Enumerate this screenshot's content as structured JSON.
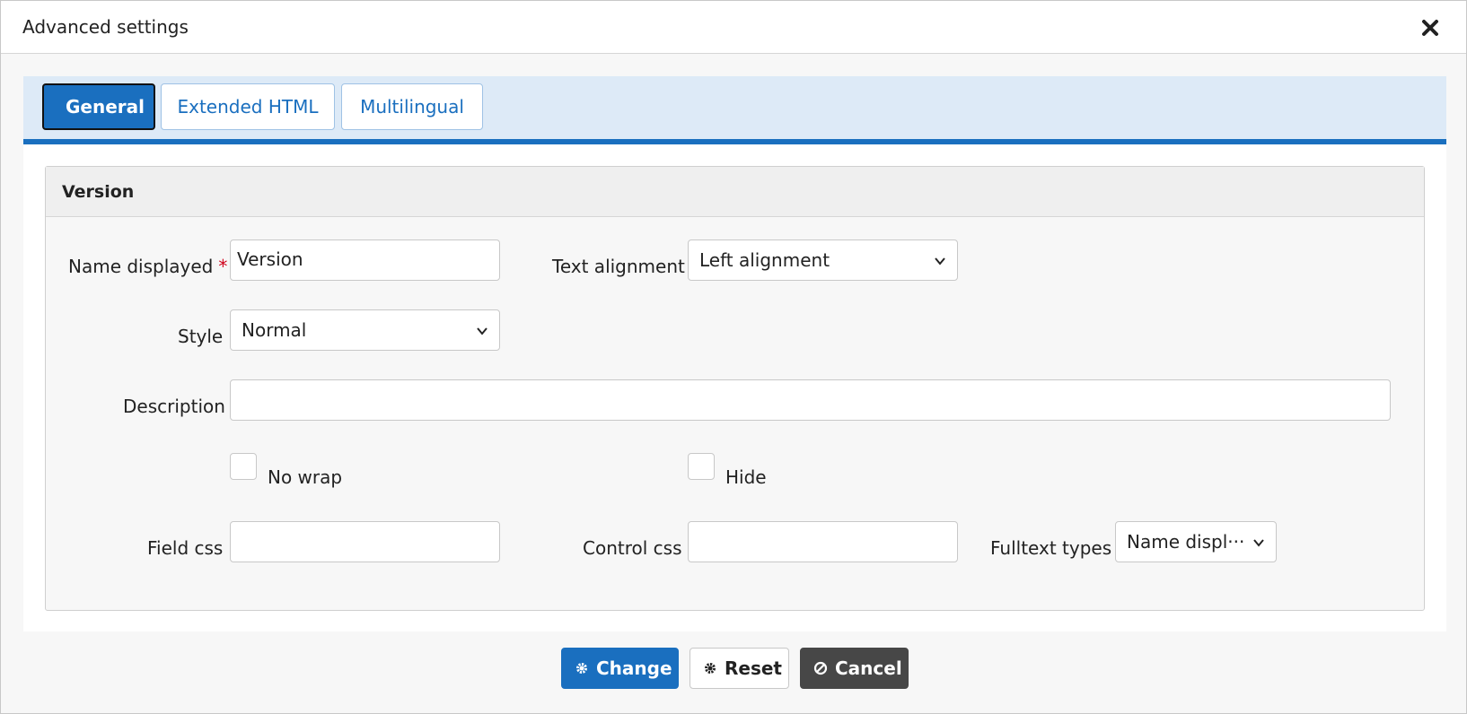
{
  "dialog": {
    "title": "Advanced settings",
    "close_icon": "close-icon"
  },
  "tabs": [
    {
      "label": "General",
      "active": true
    },
    {
      "label": "Extended HTML",
      "active": false
    },
    {
      "label": "Multilingual",
      "active": false
    }
  ],
  "panel": {
    "title": "Version"
  },
  "form": {
    "name_displayed": {
      "label": "Name displayed",
      "required_mark": "*",
      "value": "Version"
    },
    "text_alignment": {
      "label": "Text alignment",
      "value": "Left alignment"
    },
    "style": {
      "label": "Style",
      "value": "Normal"
    },
    "description": {
      "label": "Description",
      "value": ""
    },
    "no_wrap": {
      "label": "No wrap",
      "checked": false
    },
    "hide": {
      "label": "Hide",
      "checked": false
    },
    "field_css": {
      "label": "Field css",
      "value": ""
    },
    "control_css": {
      "label": "Control css",
      "value": ""
    },
    "fulltext_types": {
      "label": "Fulltext types",
      "value": "Name displ···"
    }
  },
  "footer": {
    "change_label": "Change",
    "reset_label": "Reset",
    "cancel_label": "Cancel"
  },
  "colors": {
    "accent": "#1a6fbf",
    "tabbar_bg": "#ddeaf7",
    "cancel_bg": "#474747",
    "required": "#d0021b"
  }
}
